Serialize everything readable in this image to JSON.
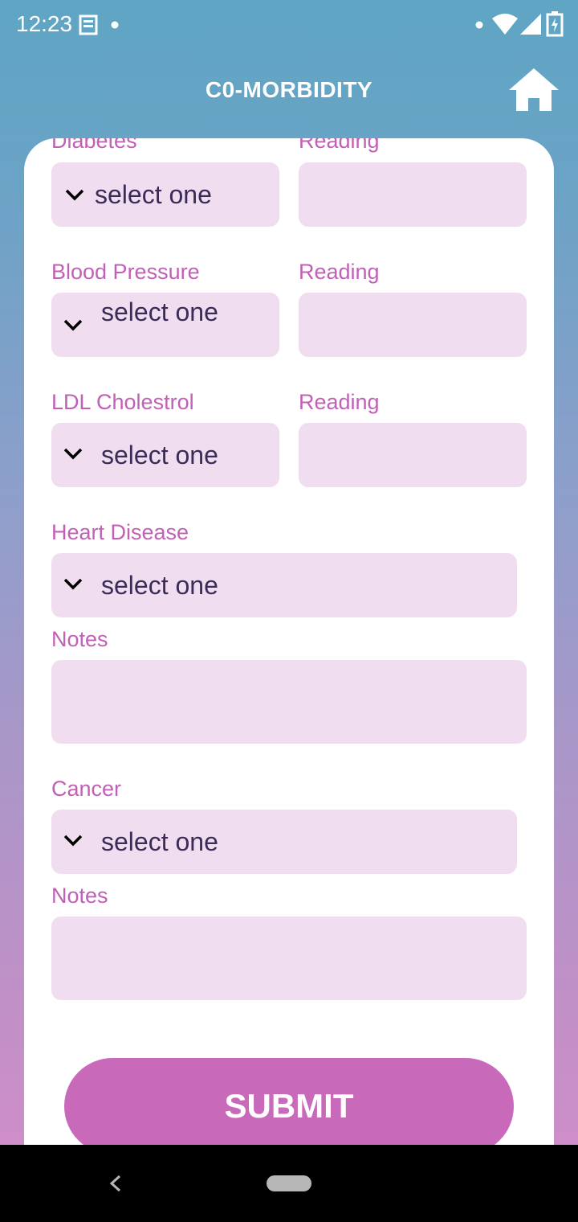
{
  "status_bar": {
    "time": "12:23"
  },
  "header": {
    "title": "C0-MORBIDITY",
    "home_icon": "home-icon"
  },
  "form": {
    "diabetes": {
      "label": "Diabetes",
      "select": "select one",
      "reading_label": "Reading",
      "reading_value": ""
    },
    "blood_pressure": {
      "label": "Blood Pressure",
      "select": "select one",
      "reading_label": "Reading",
      "reading_value": ""
    },
    "ldl": {
      "label": "LDL Cholestrol",
      "select": "select one",
      "reading_label": "Reading",
      "reading_value": ""
    },
    "heart_disease": {
      "label": "Heart Disease",
      "select": "select one",
      "notes_label": "Notes",
      "notes_value": ""
    },
    "cancer": {
      "label": "Cancer",
      "select": "select one",
      "notes_label": "Notes",
      "notes_value": ""
    }
  },
  "submit_label": "SUBMIT",
  "colors": {
    "accent": "#c869b9",
    "label": "#c25fb6",
    "field_bg": "#f1ddf0"
  }
}
